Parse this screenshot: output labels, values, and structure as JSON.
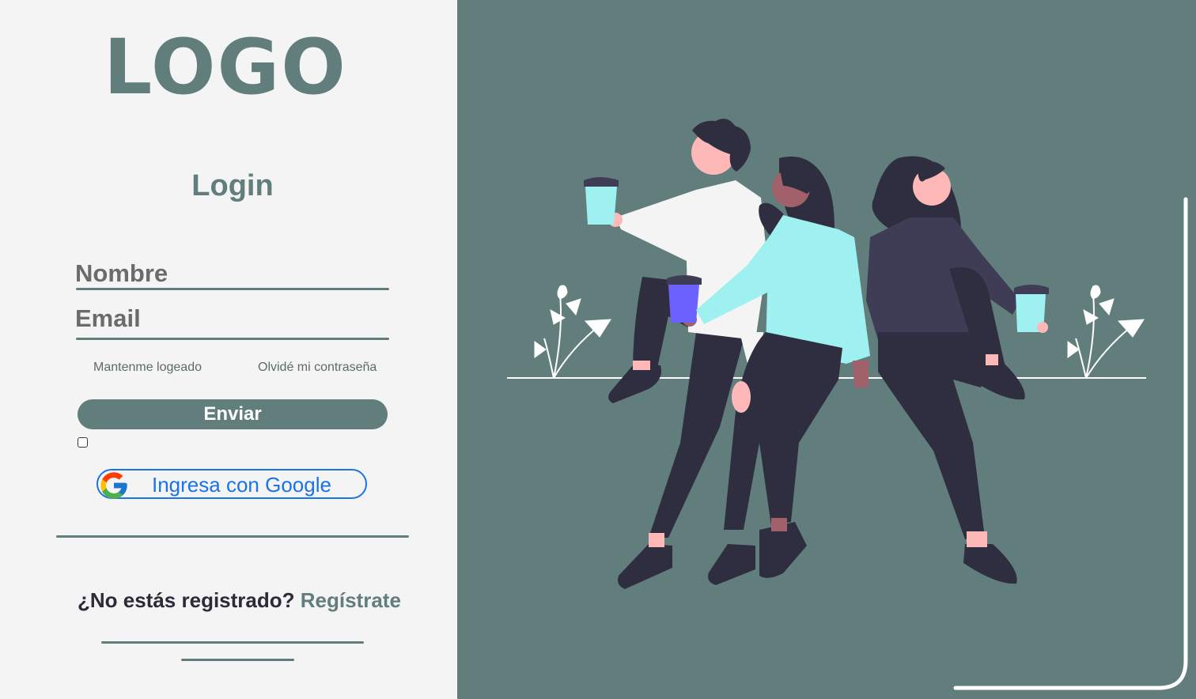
{
  "brand": {
    "logo_text": "LOGO"
  },
  "form": {
    "title": "Login",
    "name_label": "Nombre",
    "email_label": "Email",
    "remember_label": "Mantenme logeado",
    "forgot_label": "Olvidé mi contraseña",
    "submit_label": "Enviar",
    "google_label": "Ingresa con Google"
  },
  "register": {
    "question": "¿No estás registrado?",
    "link": "Regístrate"
  },
  "colors": {
    "accent": "#617e7c",
    "panel_bg": "#f4f4f4",
    "google_blue": "#1a73e8",
    "shirt_teal": "#9ff0f0",
    "dark_purple": "#3f3d56",
    "dark_pants": "#2f2e41",
    "cup_violet": "#6c63ff"
  },
  "illustration": {
    "name": "friends-with-coffee-illustration"
  }
}
